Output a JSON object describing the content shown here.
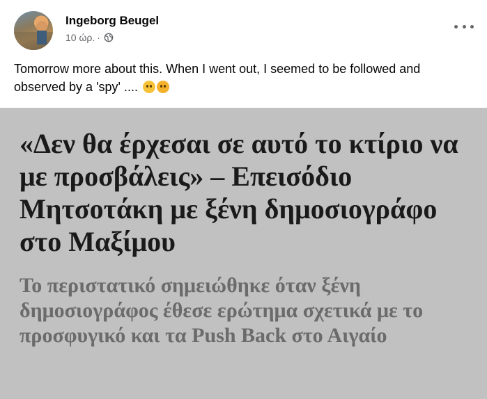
{
  "post": {
    "author": "Ingeborg Beugel",
    "time": "10 ώρ.",
    "separator": "·",
    "privacy_icon": "globe-icon",
    "more_icon": "more-options-icon",
    "text": "Tomorrow more about this. When I went out, I seemed to be followed and observed by a 'spy' ....",
    "emojis": [
      "thinking-face-emoji",
      "shocked-face-emoji"
    ]
  },
  "article": {
    "headline": "«Δεν θα έρχεσαι σε αυτό το κτίριο να με προσβάλεις» – Επεισόδιο Μητσοτάκη με ξένη δημοσιογράφο στο Μαξίμου",
    "subheadline": "Το περιστατικό σημειώθηκε όταν ξένη δημοσιογράφος έθεσε ερώτημα σχετικά με το προσφυγικό και τα Push Back στο Αιγαίο"
  },
  "colors": {
    "article_background": "#c1c1c1",
    "headline": "#1a1a1a",
    "subheadline": "#6b6b6b",
    "meta_text": "#65676b"
  }
}
